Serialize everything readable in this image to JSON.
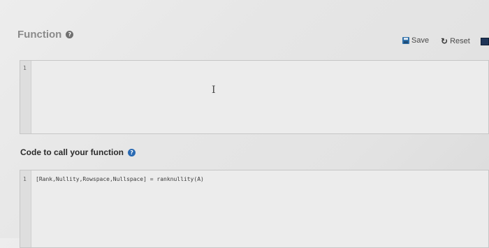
{
  "function_section": {
    "title": "Function",
    "help_icon": "help-icon",
    "toolbar": {
      "save_label": "Save",
      "reset_label": "Reset"
    },
    "editor": {
      "line_number": "1",
      "code": ""
    }
  },
  "call_section": {
    "title": "Code to call your function",
    "help_icon": "help-icon",
    "editor": {
      "line_number": "1",
      "code": "[Rank,Nullity,Rowspace,Nullspace] = ranknullity(A)"
    }
  },
  "colors": {
    "accent": "#2a6ab3",
    "save_icon": "#2f6fa8"
  }
}
